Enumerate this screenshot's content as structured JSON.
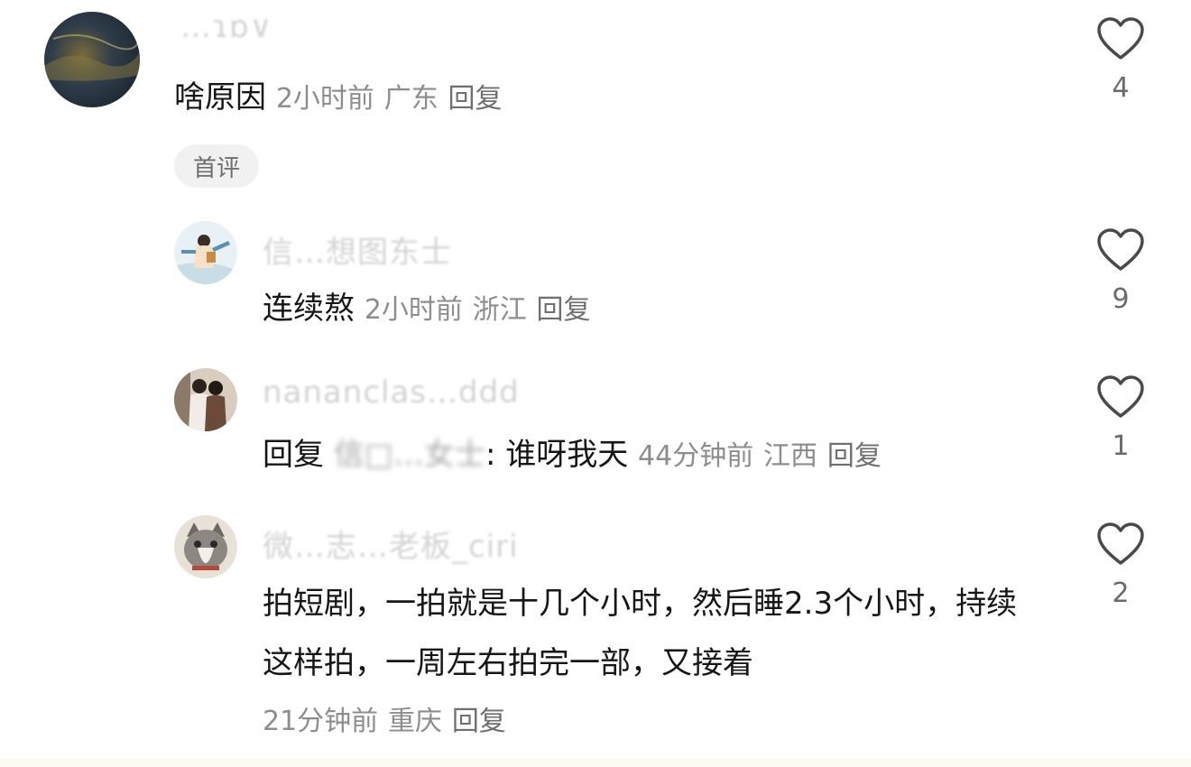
{
  "comments": [
    {
      "username": "…ɿɒ∨",
      "text": "啥原因",
      "time": "2小时前",
      "location": "广东",
      "reply_label": "回复",
      "badge": "首评",
      "likes": "4"
    },
    {
      "username": "信…想图东士",
      "text": "连续熬",
      "time": "2小时前",
      "location": "浙江",
      "reply_label": "回复",
      "likes": "9"
    },
    {
      "username": "nananclas…ddd",
      "reply_prefix": "回复",
      "reply_to": "信□…女士",
      "text": ": 谁呀我天",
      "time": "44分钟前",
      "location": "江西",
      "reply_label": "回复",
      "likes": "1"
    },
    {
      "username": "微…志…老板_ciri",
      "text": "拍短剧，一拍就是十几个小时，然后睡2.3个小时，持续这样拍，一周左右拍完一部，又接着",
      "time": "21分钟前",
      "location": "重庆",
      "reply_label": "回复",
      "likes": "2"
    }
  ],
  "icons": {
    "like": "heart-outline-icon"
  },
  "colors": {
    "meta": "#8d8d8d",
    "badge_bg": "#f1f1f1"
  }
}
